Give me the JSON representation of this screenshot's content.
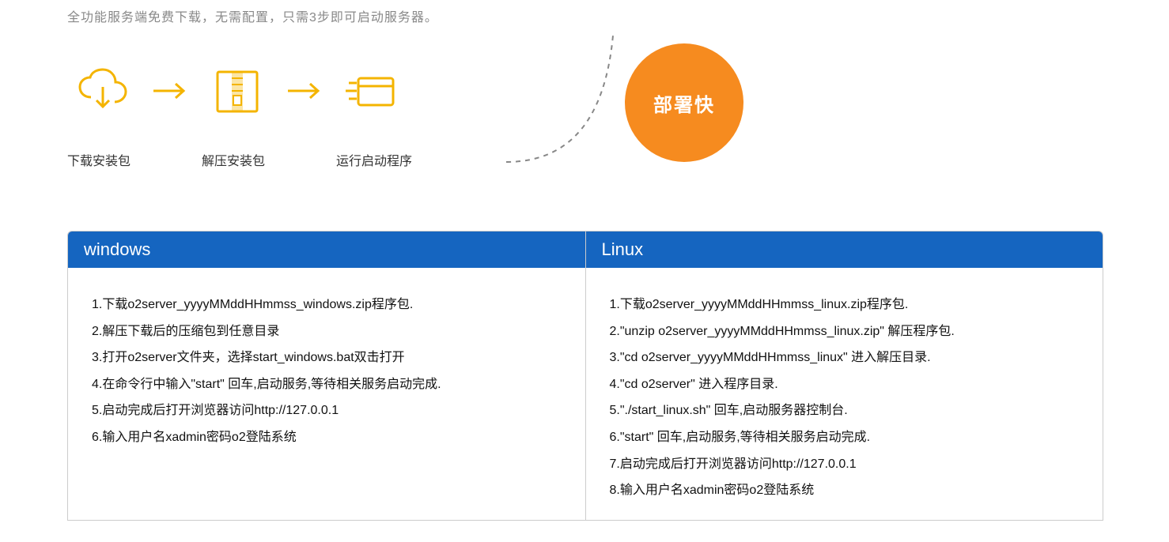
{
  "intro": "全功能服务端免费下载，无需配置，只需3步即可启动服务器。",
  "steps": {
    "s1": "下载安装包",
    "s2": "解压安装包",
    "s3": "运行启动程序"
  },
  "badge": "部署快",
  "windows": {
    "title": "windows",
    "items": [
      "1.下载o2server_yyyyMMddHHmmss_windows.zip程序包.",
      "2.解压下载后的压缩包到任意目录",
      "3.打开o2server文件夹，选择start_windows.bat双击打开",
      "4.在命令行中输入\"start\" 回车,启动服务,等待相关服务启动完成.",
      "5.启动完成后打开浏览器访问http://127.0.0.1",
      "6.输入用户名xadmin密码o2登陆系统"
    ]
  },
  "linux": {
    "title": "Linux",
    "items": [
      "1.下载o2server_yyyyMMddHHmmss_linux.zip程序包.",
      "2.\"unzip o2server_yyyyMMddHHmmss_linux.zip\" 解压程序包.",
      "3.\"cd o2server_yyyyMMddHHmmss_linux\" 进入解压目录.",
      "4.\"cd o2server\" 进入程序目录.",
      "5.\"./start_linux.sh\" 回车,启动服务器控制台.",
      "6.\"start\" 回车,启动服务,等待相关服务启动完成.",
      "7.启动完成后打开浏览器访问http://127.0.0.1",
      "8.输入用户名xadmin密码o2登陆系统"
    ]
  }
}
